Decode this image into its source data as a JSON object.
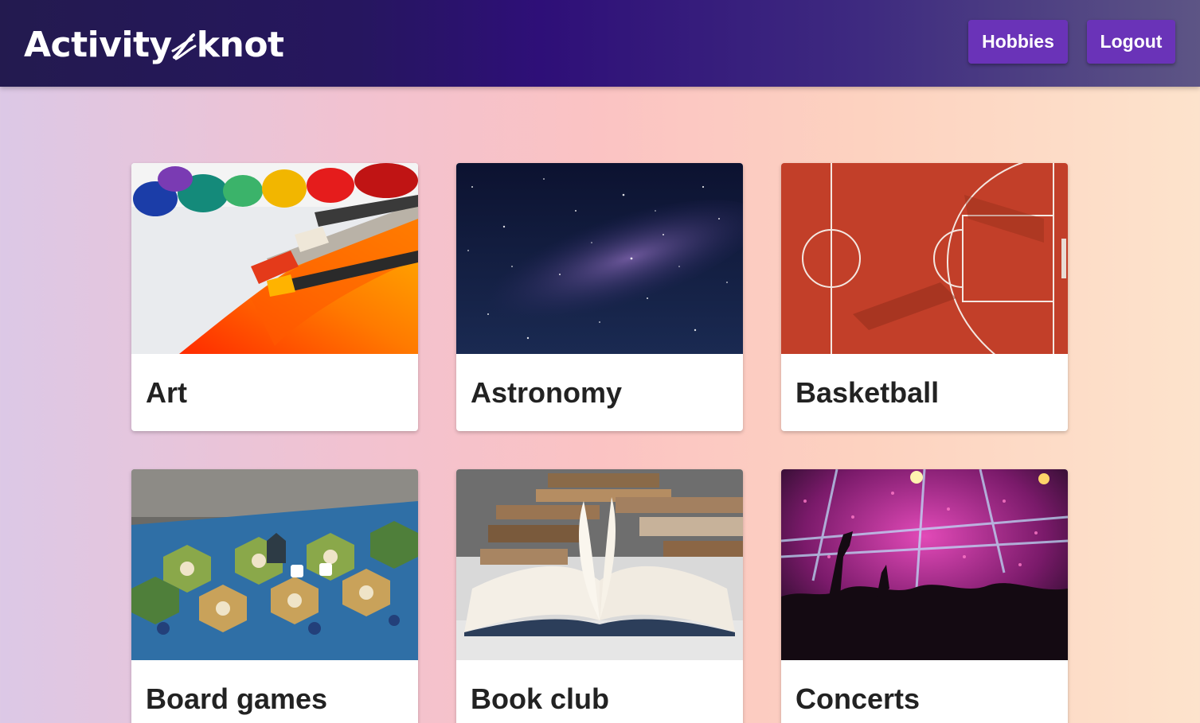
{
  "app": {
    "logo_left": "Activity",
    "logo_right": "knot",
    "logo_icon": "knot-icon"
  },
  "nav": {
    "hobbies_label": "Hobbies",
    "logout_label": "Logout"
  },
  "colors": {
    "topbar_accent": "#2e0f78",
    "button": "#6a33b8",
    "card_title": "#222222"
  },
  "hobbies": [
    {
      "name": "Art",
      "image": "paint-brushes-photo"
    },
    {
      "name": "Astronomy",
      "image": "starry-sky-photo"
    },
    {
      "name": "Basketball",
      "image": "basketball-court-photo"
    },
    {
      "name": "Board games",
      "image": "board-game-photo"
    },
    {
      "name": "Book club",
      "image": "books-photo"
    },
    {
      "name": "Concerts",
      "image": "concert-crowd-photo"
    }
  ]
}
